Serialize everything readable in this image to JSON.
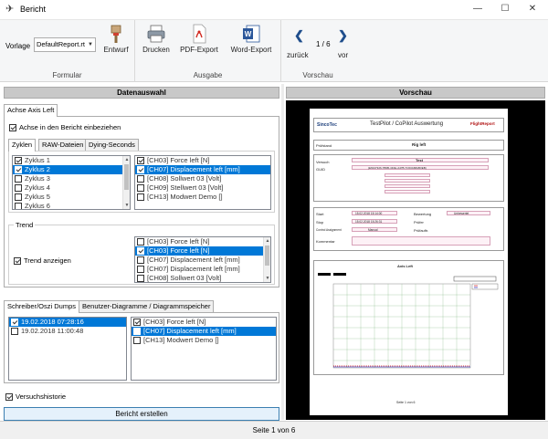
{
  "window": {
    "title": "Bericht",
    "minimize_icon": "minimize-icon",
    "maximize_icon": "maximize-icon",
    "close_icon": "close-icon"
  },
  "ribbon": {
    "formular": {
      "group_label": "Formular",
      "vorlage_label": "Vorlage",
      "vorlage_value": "DefaultReport.rt",
      "entwurf_label": "Entwurf"
    },
    "ausgabe": {
      "group_label": "Ausgabe",
      "drucken_label": "Drucken",
      "pdf_label": "PDF-Export",
      "word_label": "Word-Export"
    },
    "vorschau": {
      "group_label": "Vorschau",
      "back_label": "zurück",
      "forward_label": "vor",
      "page_counter": "1 / 6"
    }
  },
  "left": {
    "header": "Datenauswahl",
    "axis_tab": "Achse Axis Left",
    "include_axis_label": "Achse in den Bericht einbeziehen",
    "subtabs": [
      "Zyklen",
      "RAW-Dateien",
      "Dying-Seconds"
    ],
    "zyklen": [
      {
        "label": "Zyklus 1",
        "checked": true,
        "selected": false
      },
      {
        "label": "Zyklus 2",
        "checked": true,
        "selected": true
      },
      {
        "label": "Zyklus 3",
        "checked": false,
        "selected": false
      },
      {
        "label": "Zyklus 4",
        "checked": false,
        "selected": false
      },
      {
        "label": "Zyklus 5",
        "checked": false,
        "selected": false
      },
      {
        "label": "Zyklus 6",
        "checked": false,
        "selected": false
      }
    ],
    "channels": [
      {
        "label": "[CH03] Force left [N]",
        "checked": true,
        "selected": false
      },
      {
        "label": "[CH07] Displacement left [mm]",
        "checked": true,
        "selected": true
      },
      {
        "label": "[CH08] Sollwert 03 [Volt]",
        "checked": false,
        "selected": false
      },
      {
        "label": "[CH09] Stellwert 03 [Volt]",
        "checked": false,
        "selected": false
      },
      {
        "label": "[CH13] Modwert Demo []",
        "checked": false,
        "selected": false
      }
    ],
    "trend": {
      "frame_label": "Trend",
      "show_label": "Trend anzeigen",
      "channels": [
        {
          "label": "[CH03] Force left [N]",
          "checked": false,
          "selected": false
        },
        {
          "label": "[CH03] Force left [N]",
          "checked": true,
          "selected": true
        },
        {
          "label": "[CH07] Displacement left [mm]",
          "checked": false,
          "selected": false
        },
        {
          "label": "[CH07] Displacement left [mm]",
          "checked": false,
          "selected": false
        },
        {
          "label": "[CH08] Sollwert 03 [Volt]",
          "checked": false,
          "selected": false
        }
      ]
    },
    "dump_tabs": [
      "Schreiber/Oszi Dumps",
      "Benutzer-Diagramme / Diagrammspeicher"
    ],
    "dumps": [
      {
        "label": "19.02.2018 07:28:16",
        "checked": true,
        "selected": true
      },
      {
        "label": "19.02.2018 11:00:48",
        "checked": false,
        "selected": false
      }
    ],
    "dump_channels": [
      {
        "label": "[CH03] Force left [N]",
        "checked": true,
        "selected": false
      },
      {
        "label": "[CH07] Displacement left [mm]",
        "checked": false,
        "selected": true
      },
      {
        "label": "[CH13] Modwert Demo []",
        "checked": false,
        "selected": false
      }
    ],
    "history_label": "Versuchshistorie",
    "create_button": "Bericht erstellen"
  },
  "preview": {
    "header": "Vorschau",
    "report": {
      "logo_left": "SincoTec",
      "title": "TestPilot / CoPilot Auswertung",
      "logo_right": "FlightReport",
      "row_pruefstand": "Prüfstand",
      "rig": "Rig left",
      "versuch": "Versuch",
      "test": "Test",
      "guid": "GUID",
      "guid_value": "{E6347326-7B6B-4F4E-A47B-7C63A68AB3EB}",
      "start": "Start",
      "start_value": "15.02.2018 15:14:00",
      "stop": "Stop",
      "stop_value": "15.02.2018 15:26:31",
      "bewertung": "Bewertung",
      "bewertung_value": "Unbewertet",
      "pruefer": "Prüfer",
      "control": "Control Assignment",
      "control_value": "Manual",
      "pruefauftr": "Prüfauftr.",
      "kommentar": "Kommentar",
      "axis_title": "Axis Left",
      "page_footer": "Seite 1 von 6"
    }
  },
  "status": "Seite 1 von 6"
}
